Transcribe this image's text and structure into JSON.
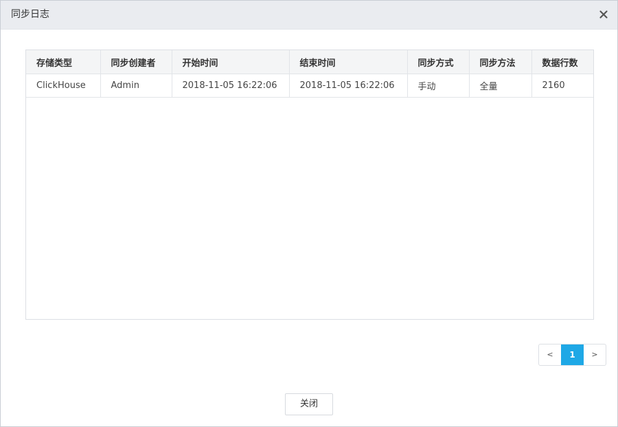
{
  "dialog": {
    "title": "同步日志",
    "close_icon": "close-icon"
  },
  "table": {
    "columns": [
      "存储类型",
      "同步创建者",
      "开始时间",
      "结束时间",
      "同步方式",
      "同步方法",
      "数据行数"
    ],
    "rows": [
      [
        "ClickHouse",
        "Admin",
        "2018-11-05 16:22:06",
        "2018-11-05 16:22:06",
        "手动",
        "全量",
        "2160"
      ]
    ]
  },
  "pagination": {
    "prev": "<",
    "current_page": "1",
    "next": ">",
    "active_color": "#1ea8e6"
  },
  "footer": {
    "close_label": "关闭"
  }
}
